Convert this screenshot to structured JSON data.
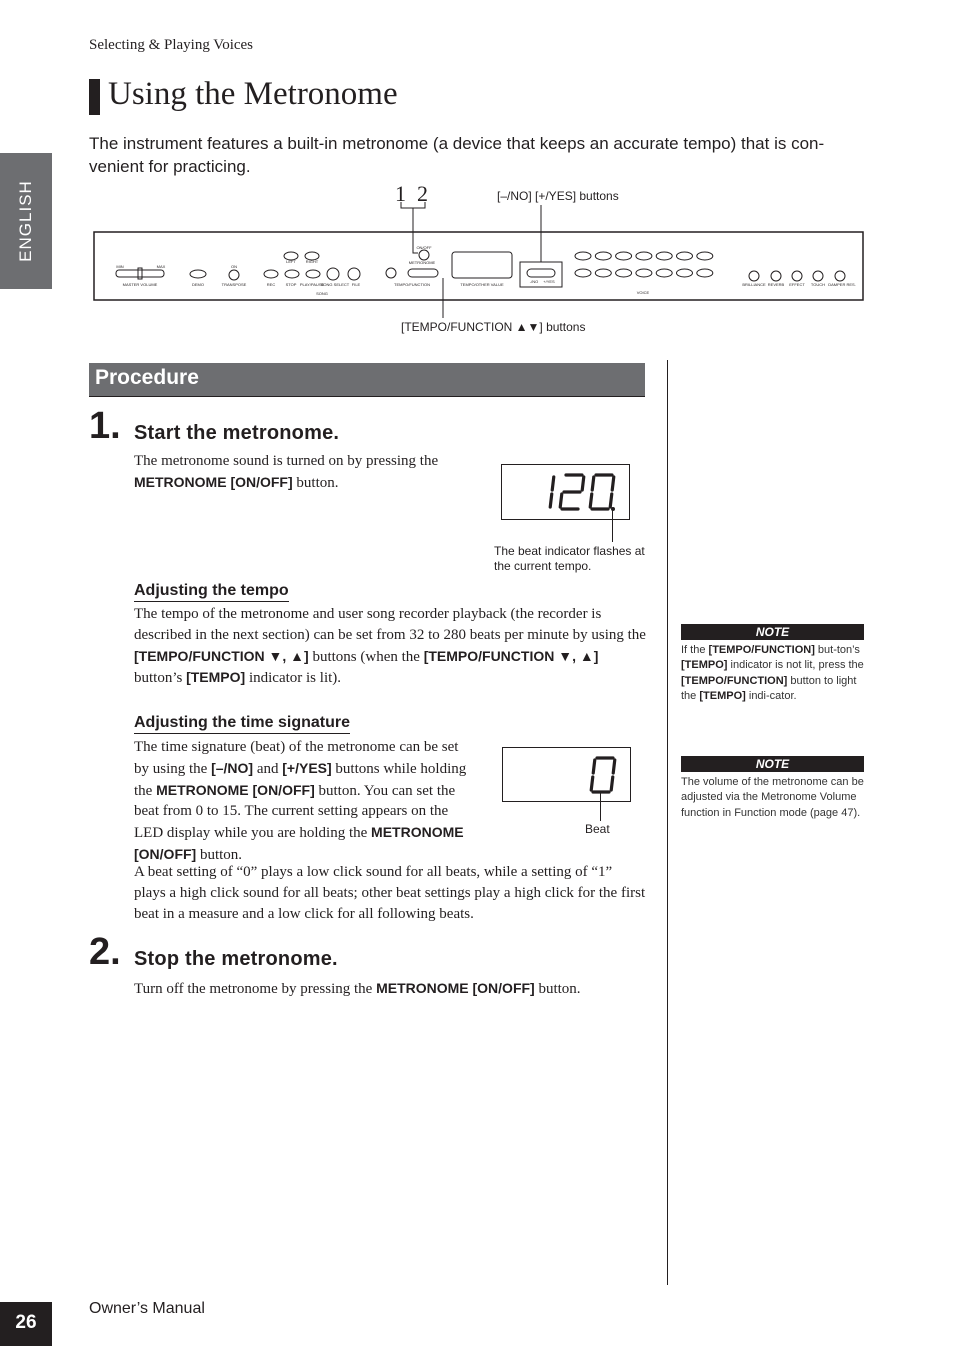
{
  "header": {
    "running_head": "Selecting & Playing Voices"
  },
  "side_tab": {
    "label": "ENGLISH"
  },
  "title": "Using the Metronome",
  "intro": "The instrument features a built-in metronome (a device that keeps an accurate tempo) that is con-venient for practicing.",
  "panel": {
    "callout_numbers": [
      "1",
      "2"
    ],
    "callout_yes_no": "[–/NO] [+/YES] buttons",
    "callout_tempo": "[TEMPO/FUNCTION ▲▼] buttons",
    "labels": {
      "master_volume": "MASTER VOLUME",
      "min": "MIN",
      "max": "MAX",
      "demo": "DEMO",
      "transpose": "TRANSPOSE",
      "on": "ON",
      "rec": "REC",
      "stop": "STOP",
      "play": "PLAY/PAUSE",
      "song_select": "SONG SELECT",
      "file": "FILE",
      "song": "SONG",
      "left": "LEFT",
      "right": "RIGHT",
      "metronome": "METRONOME",
      "on_off": "ON/OFF",
      "tempo_function": "TEMPO/FUNCTION",
      "tempo_value": "TEMPO/OTHER VALUE",
      "no": "-/NO",
      "yes": "+/YES",
      "voice": "VOICE",
      "brilliance": "BRILLIANCE",
      "reverb": "REVERB",
      "effect": "EFFECT",
      "touch": "TOUCH",
      "damper": "DAMPER RES."
    }
  },
  "procedure": {
    "heading": "Procedure"
  },
  "step1": {
    "number": "1.",
    "title": "Start the metronome.",
    "text_a": "The metronome sound is turned on by pressing the ",
    "text_b": "METRONOME [ON/OFF]",
    "text_c": " button.",
    "display_value": "120",
    "display_caption": "The beat indicator flashes at the current tempo."
  },
  "tempo": {
    "heading": "Adjusting the tempo",
    "t1": "The tempo of the metronome and user song recorder playback (the recorder is described in the next section) can be set from 32 to 280 beats per minute by using the ",
    "b1": "[TEMPO/FUNCTION ▼, ▲]",
    "t2": " buttons (when the ",
    "b2": "[TEMPO/FUNCTION ▼, ▲]",
    "t3": " button’s ",
    "b3": "[TEMPO]",
    "t4": " indicator is lit)."
  },
  "timesig": {
    "heading": "Adjusting the time signature",
    "t1": "The time signature (beat) of the metronome can be set by using the ",
    "b1": "[–/NO]",
    "t2": " and ",
    "b2": "[+/YES]",
    "t3": " buttons while holding the ",
    "b3": "METRONOME [ON/OFF]",
    "t4": " button. You can set the beat from 0 to 15. The current setting appears on the LED display while you are holding the ",
    "b4": "METRONOME [ON/OFF]",
    "t5": " button.",
    "t6": "A beat setting of “0” plays a low click sound for all beats, while a setting of “1” plays a high click sound for all beats; other beat settings play a high click for the first beat in a measure and a low click for all following beats.",
    "display_value": "0",
    "display_caption": "Beat"
  },
  "step2": {
    "number": "2.",
    "title": "Stop the metronome.",
    "t1": "Turn off the metronome by pressing the ",
    "b1": "METRONOME [ON/OFF]",
    "t2": " button."
  },
  "notes": [
    {
      "heading": "NOTE",
      "t1": "If the ",
      "b1": "[TEMPO/FUNCTION]",
      "t2": " but-ton’s ",
      "b2": "[TEMPO]",
      "t3": " indicator is not lit, press the ",
      "b3": "[TEMPO/FUNCTION]",
      "t4": " button to light the ",
      "b4": "[TEMPO]",
      "t5": " indi-cator."
    },
    {
      "heading": "NOTE",
      "t1": "The volume of the metronome can be adjusted via the Metronome Volume function in Function mode (page 47)."
    }
  ],
  "footer": {
    "page_number": "26",
    "manual": "Owner’s Manual"
  },
  "colors": {
    "tab_gray": "#6d6e71",
    "procedure_bar": "#6d6e71",
    "dark": "#231f20"
  }
}
